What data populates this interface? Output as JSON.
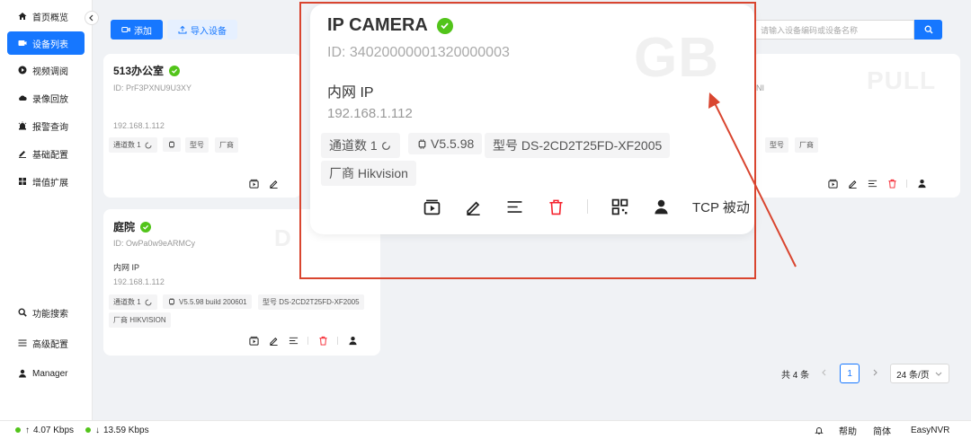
{
  "sidebar": {
    "items": [
      {
        "label": "首页概览",
        "icon": "home-icon"
      },
      {
        "label": "设备列表",
        "icon": "device-list-icon",
        "active": true
      },
      {
        "label": "视频调阅",
        "icon": "play-circle-icon"
      },
      {
        "label": "录像回放",
        "icon": "cloud-icon"
      },
      {
        "label": "报警查询",
        "icon": "alarm-icon"
      },
      {
        "label": "基础配置",
        "icon": "edit-icon"
      },
      {
        "label": "增值扩展",
        "icon": "apps-icon"
      }
    ],
    "bottom": [
      {
        "label": "功能搜索",
        "icon": "search-icon"
      },
      {
        "label": "高级配置",
        "icon": "menu-icon"
      },
      {
        "label": "Manager",
        "icon": "user-icon"
      }
    ]
  },
  "toolbar": {
    "add_label": "添加",
    "import_label": "导入设备",
    "search_placeholder": "请输入设备编码或设备名称"
  },
  "cards": [
    {
      "name": "513办公室",
      "id": "ID: PrF3PXNU9U3XY",
      "ip": "192.168.1.112",
      "channels": "通道数 1",
      "model_label": "型号",
      "vendor_label": "厂商"
    },
    {
      "name": "庭院",
      "id": "ID: OwPa0w9eARMCy",
      "ip_label": "内网 IP",
      "ip": "192.168.1.112",
      "channels": "通道数 1",
      "version": "V5.5.98 build 200601",
      "model": "型号 DS-2CD2T25FD-XF2005",
      "vendor": "厂商 HIKVISION",
      "watermark": "D"
    },
    {
      "id_fragment": "NI",
      "model_label": "型号",
      "vendor_label": "厂商",
      "watermark": "PULL"
    }
  ],
  "zoom": {
    "name": "IP CAMERA",
    "id": "ID: 34020000001320000003",
    "ip_label": "内网 IP",
    "ip": "192.168.1.112",
    "channels": "通道数 1",
    "version": "V5.5.98",
    "model": "型号 DS-2CD2T25FD-XF2005",
    "vendor": "厂商 Hikvision",
    "protocol": "TCP 被动",
    "watermark": "GB"
  },
  "pagination": {
    "total": "共 4 条",
    "page": "1",
    "page_size": "24 条/页"
  },
  "status": {
    "upload": "4.07 Kbps",
    "download": "13.59 Kbps",
    "help": "帮助",
    "lang": "简体",
    "brand": "EasyNVR"
  },
  "colors": {
    "accent": "#1677ff",
    "online": "#52c41a",
    "danger": "#f5222d",
    "highlight_box": "#d9452f"
  }
}
